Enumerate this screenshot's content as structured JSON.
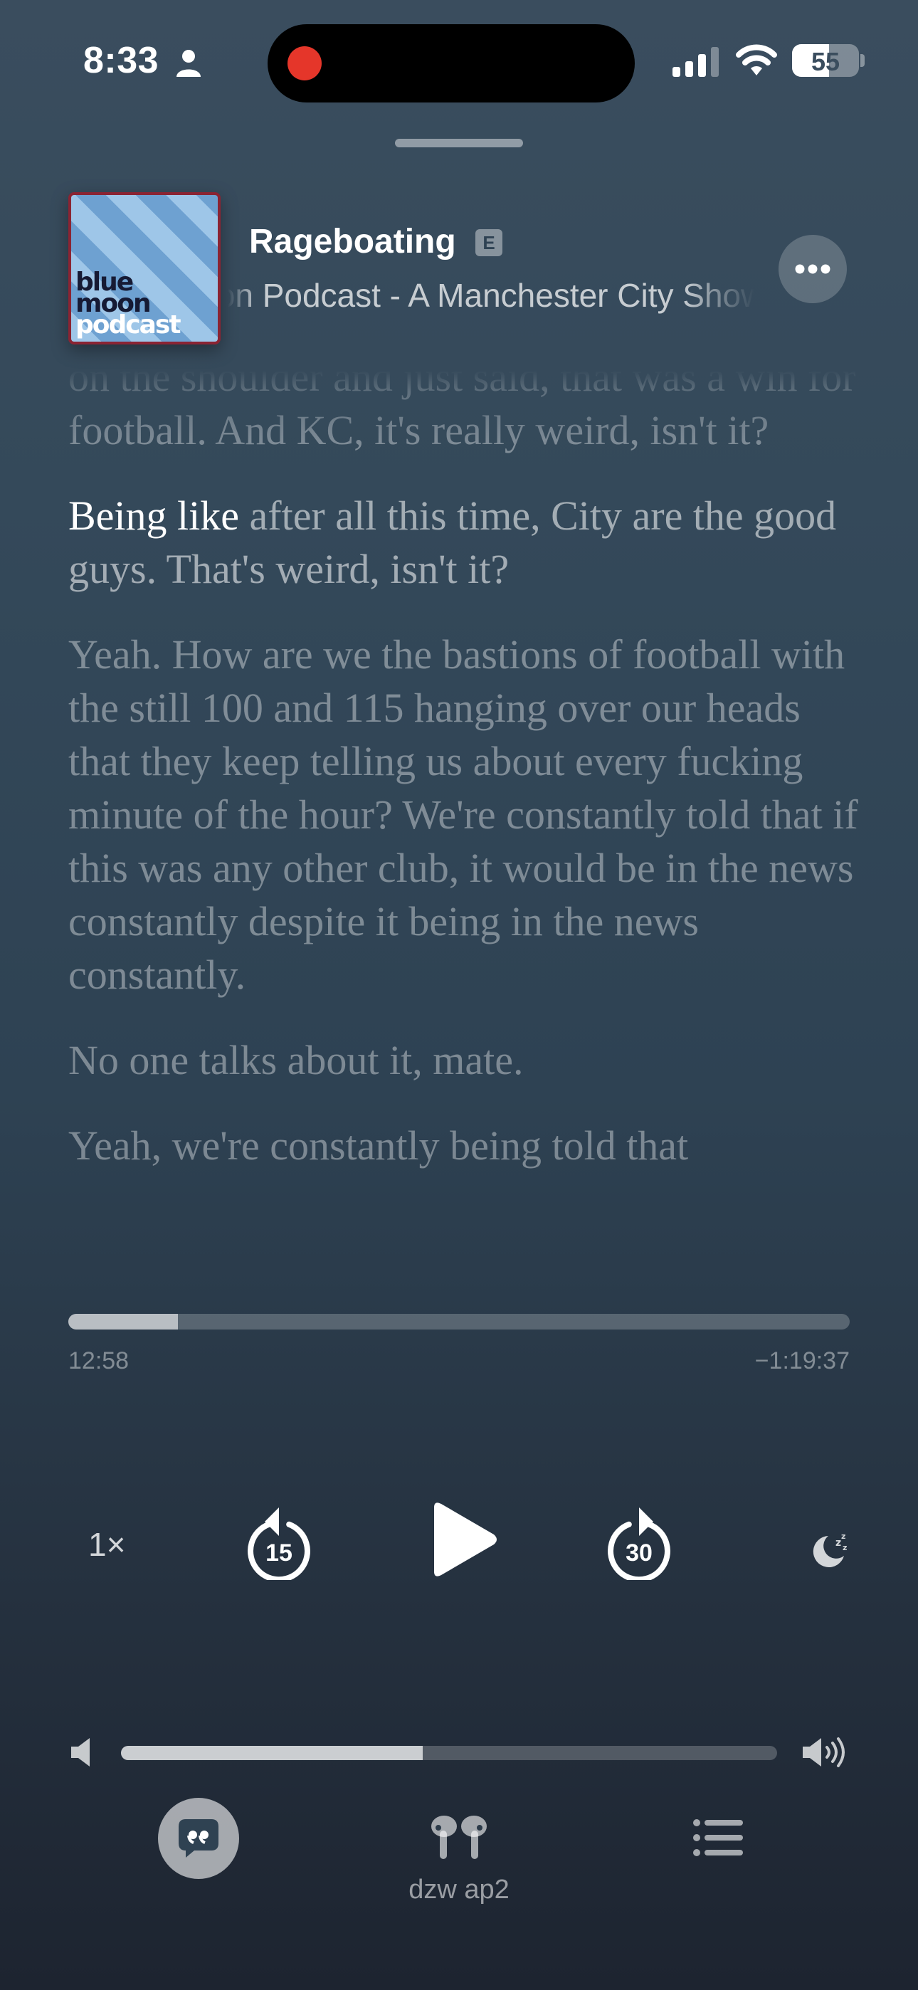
{
  "status_bar": {
    "time": "8:33",
    "battery": "55",
    "battery_level_percent": 55,
    "icons": [
      "person-icon",
      "signal-icon",
      "wifi-icon",
      "battery-icon"
    ],
    "recording_color": "#e5362a"
  },
  "now_playing": {
    "episode_title": "Rageboating",
    "explicit_badge": "E",
    "show_title": "Blue Moon Podcast - A Manchester City Show",
    "artwork": {
      "line1": "blue",
      "line2": "moon",
      "line3": "podcast"
    }
  },
  "transcript": {
    "paragraphs": [
      {
        "text": "on the shoulder and just said, that was a win for football. And KC, it's really weird, isn't it?"
      },
      {
        "spoken": "Being like",
        "text": " after all this time, City are the good guys. That's weird, isn't it?"
      },
      {
        "text": "Yeah. How are we the bastions of football with the still 100 and 115 hanging over our heads that they keep telling us about every fucking minute of the hour? We're constantly told that if this was any other club, it would be in the news constantly despite it being in the news constantly."
      },
      {
        "text": "No one talks about it, mate."
      },
      {
        "text": "Yeah, we're constantly being told that"
      }
    ]
  },
  "playback": {
    "elapsed": "12:58",
    "remaining": "−1:19:37",
    "progress_fraction": 0.14,
    "speed": "1×",
    "skip_back_seconds": "15",
    "skip_forward_seconds": "30"
  },
  "volume": {
    "level_fraction": 0.46
  },
  "toolbar": {
    "airplay_device": "dzw ap2",
    "icons": [
      "lyrics-icon",
      "airpods-icon",
      "queue-icon"
    ]
  }
}
